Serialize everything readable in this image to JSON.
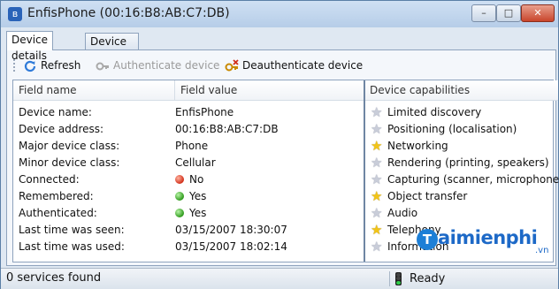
{
  "window": {
    "title": "EnfisPhone (00:16:B8:AB:C7:DB)",
    "min": "–",
    "max": "□",
    "close": "✕"
  },
  "tabs": [
    {
      "label": "Device details",
      "active": true
    },
    {
      "label": "Device services",
      "active": false
    }
  ],
  "toolbar": {
    "refresh": "Refresh",
    "authenticate": "Authenticate device",
    "deauthenticate": "Deauthenticate device"
  },
  "headers": {
    "name": "Field name",
    "value": "Field value",
    "caps": "Device capabilities"
  },
  "details": [
    {
      "name": "Device name:",
      "value": "EnfisPhone"
    },
    {
      "name": "Device address:",
      "value": "00:16:B8:AB:C7:DB"
    },
    {
      "name": "Major device class:",
      "value": "Phone"
    },
    {
      "name": "Minor device class:",
      "value": "Cellular"
    },
    {
      "name": "Connected:",
      "value": "No",
      "status": "red"
    },
    {
      "name": "Remembered:",
      "value": "Yes",
      "status": "green"
    },
    {
      "name": "Authenticated:",
      "value": "Yes",
      "status": "green"
    },
    {
      "name": "Last time was seen:",
      "value": "03/15/2007 18:30:07"
    },
    {
      "name": "Last time was used:",
      "value": "03/15/2007 18:02:14"
    }
  ],
  "capabilities": [
    {
      "label": "Limited discovery",
      "enabled": false
    },
    {
      "label": "Positioning (localisation)",
      "enabled": false
    },
    {
      "label": "Networking",
      "enabled": true
    },
    {
      "label": "Rendering (printing, speakers)",
      "enabled": false
    },
    {
      "label": "Capturing (scanner, microphone)",
      "enabled": false
    },
    {
      "label": "Object transfer",
      "enabled": true
    },
    {
      "label": "Audio",
      "enabled": false
    },
    {
      "label": "Telephony",
      "enabled": true
    },
    {
      "label": "Information",
      "enabled": false
    }
  ],
  "status": {
    "services": "0 services found",
    "ready": "Ready"
  },
  "watermark": {
    "text": "aimienphi",
    "sub": ".vn",
    "icon": "T"
  },
  "colors": {
    "star_on": "#f2c417",
    "star_off": "#c9cdd9",
    "red": "#d2301a",
    "green": "#2f9a1c"
  }
}
